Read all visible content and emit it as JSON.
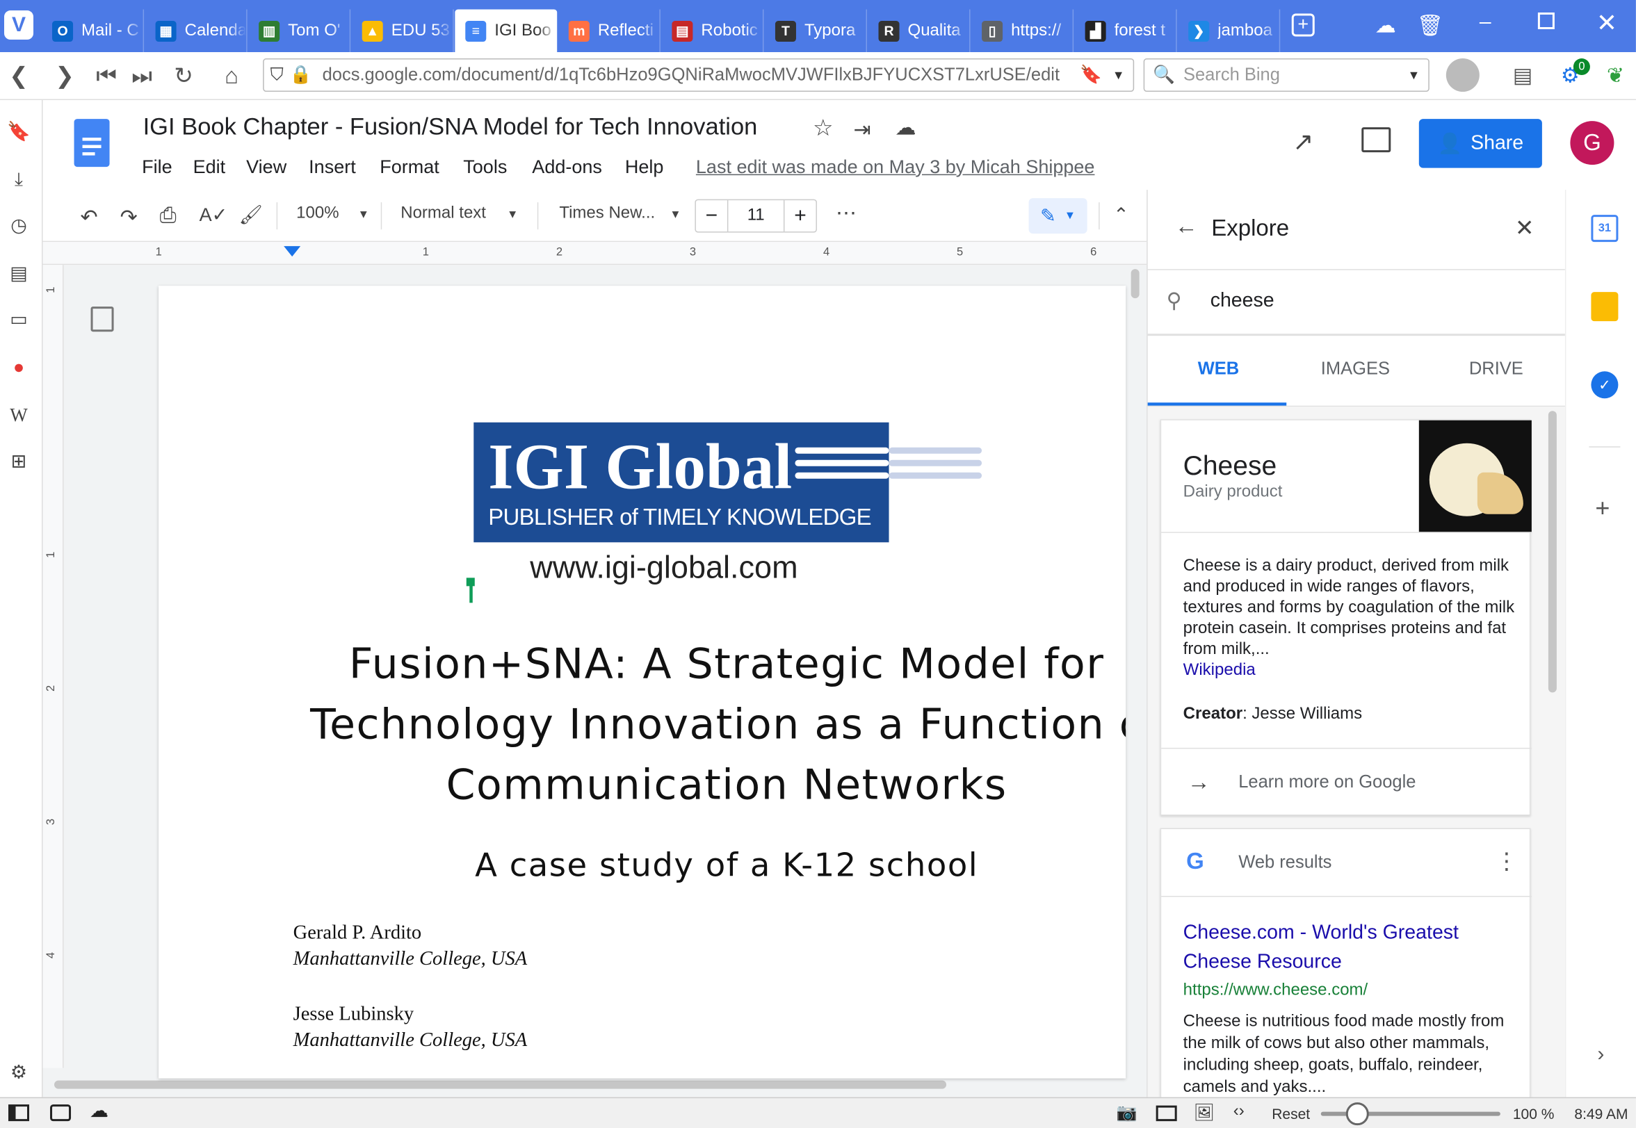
{
  "browser": {
    "tabs": [
      {
        "label": "Mail - C",
        "color": "#0a64c8",
        "icon": "O"
      },
      {
        "label": "Calenda",
        "color": "#0a64c8",
        "icon": "▦"
      },
      {
        "label": "Tom O'",
        "color": "#2e7d32",
        "icon": "▥"
      },
      {
        "label": "EDU 53",
        "color": "#fbbc04",
        "icon": "▲"
      },
      {
        "label": "IGI Boo",
        "color": "#4285f4",
        "icon": "≡"
      },
      {
        "label": "Reflecti",
        "color": "#ff7043",
        "icon": "m"
      },
      {
        "label": "Robotic",
        "color": "#c62828",
        "icon": "▤"
      },
      {
        "label": "Typora",
        "color": "#333333",
        "icon": "T"
      },
      {
        "label": "Qualita",
        "color": "#333333",
        "icon": "R"
      },
      {
        "label": "https://",
        "color": "#5f6368",
        "icon": "▯"
      },
      {
        "label": "forest t",
        "color": "#222222",
        "icon": "▟"
      },
      {
        "label": "jamboa",
        "color": "#1e88e5",
        "icon": "❯"
      }
    ],
    "url": "docs.google.com/document/d/1qTc6bHzo9GQNiRaMwocMVJWFIlxBJFYUCXST7LxrUSE/edit",
    "search_placeholder": "Search Bing",
    "extension_badge": "0"
  },
  "doc": {
    "title": "IGI Book Chapter - Fusion/SNA Model for Tech Innovation",
    "menus": [
      "File",
      "Edit",
      "View",
      "Insert",
      "Format",
      "Tools",
      "Add-ons",
      "Help"
    ],
    "last_edit": "Last edit was made on May 3 by Micah Shippee",
    "share_label": "Share",
    "avatar_letter": "G",
    "toolbar": {
      "zoom": "100%",
      "style": "Normal text",
      "font": "Times New...",
      "size": "11"
    },
    "ruler_labels": [
      "1",
      "1",
      "2",
      "3",
      "4",
      "5",
      "6"
    ],
    "vruler_labels": [
      "1",
      "1",
      "2",
      "3",
      "4"
    ],
    "logo": {
      "brand": "IGI Global",
      "tagline": "PUBLISHER of TIMELY KNOWLEDGE",
      "site": "www.igi-global.com"
    },
    "heading_lines": [
      "Fusion+SNA: A Strategic Model for",
      "Technology Innovation as a Function c",
      "Communication Networks"
    ],
    "subtitle": "A case study of a K-12 school",
    "authors": [
      {
        "name": "Gerald P. Ardito",
        "affiliation": "Manhattanville College, USA"
      },
      {
        "name": "Jesse Lubinsky",
        "affiliation": "Manhattanville College, USA"
      }
    ]
  },
  "explore": {
    "title": "Explore",
    "query": "cheese",
    "tabs": [
      "WEB",
      "IMAGES",
      "DRIVE"
    ],
    "knowledge": {
      "name": "Cheese",
      "type": "Dairy product",
      "description": "Cheese is a dairy product, derived from milk and produced in wide ranges of flavors, textures and forms by coagulation of the milk protein casein. It comprises proteins and fat from milk,...",
      "source": "Wikipedia",
      "creator_label": "Creator",
      "creator_value": ": Jesse Williams",
      "learn_more": "Learn more on Google"
    },
    "web_results_label": "Web results",
    "result": {
      "title": "Cheese.com - World's Greatest Cheese Resource",
      "url": "https://www.cheese.com/",
      "snippet": "Cheese is nutritious food made mostly from the milk of cows but also other mammals, including sheep, goats, buffalo, reindeer, camels and yaks...."
    }
  },
  "status": {
    "reset": "Reset",
    "zoom": "100 %",
    "time": "8:49 AM"
  }
}
